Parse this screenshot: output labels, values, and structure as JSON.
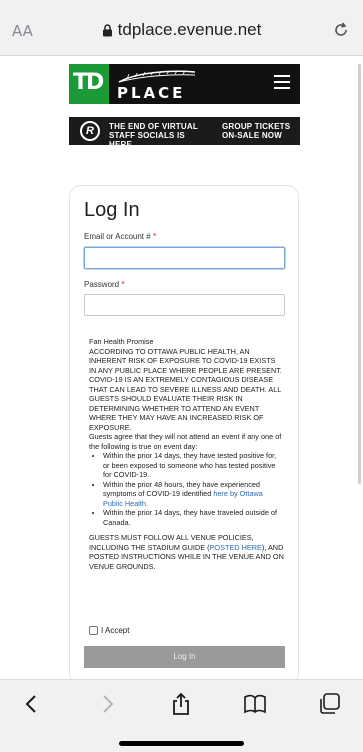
{
  "browser": {
    "text_size_label": "AA",
    "url": "tdplace.evenue.net"
  },
  "header": {
    "logo_td": "TD",
    "logo_place": "PLACE"
  },
  "banner": {
    "line1": "THE END OF VIRTUAL STAFF SOCIALS IS HERE.",
    "line2": "GROUP TICKETS ON-SALE NOW",
    "logo_letter": "R"
  },
  "login": {
    "title": "Log In",
    "email_label": "Email or Account #",
    "password_label": "Password",
    "required_mark": "*",
    "email_value": "",
    "password_value": "",
    "accept_label": "I Accept",
    "button_label": "Log In"
  },
  "promise": {
    "heading": "Fan Health Promise",
    "intro": "ACCORDING TO OTTAWA PUBLIC HEALTH, AN INHERENT RISK OF EXPOSURE TO COVID-19 EXISTS IN ANY PUBLIC PLACE WHERE PEOPLE ARE PRESENT. COVID-19 IS AN EXTREMELY CONTAGIOUS DISEASE THAT CAN LEAD TO SEVERE ILLNESS AND DEATH. ALL GUESTS SHOULD EVALUATE THEIR RISK IN DETERMINING WHETHER TO ATTEND AN EVENT WHERE THEY MAY HAVE AN INCREASED RISK OF EXPOSURE.",
    "agree": "Guests agree that they will not attend an event if any one of the following is true on event day:",
    "bullet1": "Within the prior 14 days, they have tested positive for, or been exposed to someone who has tested positive for COVID-19.",
    "bullet2_pre": "Within the prior 48 hours, they have experienced symptoms of COVID-19 identified ",
    "bullet2_link": "here by Ottawa Public Health",
    "bullet2_post": ".",
    "bullet3": "Within the prior 14 days, they have traveled outside of Canada.",
    "policy_pre": "GUESTS MUST FOLLOW ALL VENUE POLICIES, INCLUDING THE STADIUM GUIDE (",
    "policy_link": "POSTED HERE",
    "policy_post": "), AND POSTED INSTRUCTIONS WHILE IN THE VENUE AND ON VENUE GROUNDS."
  },
  "colors": {
    "td_green": "#1a9b37",
    "link_blue": "#2b6bb5",
    "button_disabled": "#9a9a9a"
  },
  "icons": [
    "lock-icon",
    "reload-icon",
    "menu-icon",
    "back-icon",
    "forward-icon",
    "share-icon",
    "bookmarks-icon",
    "tabs-icon"
  ]
}
